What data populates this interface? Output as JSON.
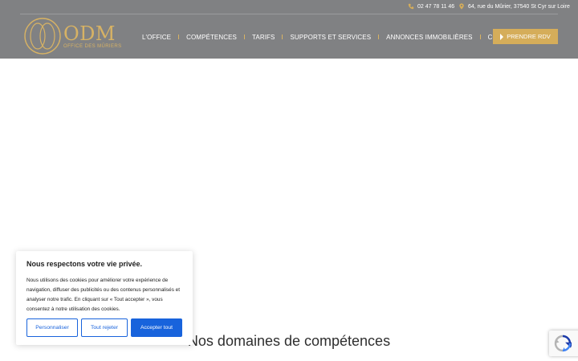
{
  "header": {
    "phone": "02 47 78 11 46",
    "address": "64, rue du Mûrier, 37540 St Cyr sur Loire",
    "logo": {
      "word": "ODM",
      "subtitle": "OFFICE DES MÛRIERS"
    },
    "nav": [
      {
        "label": "L'OFFICE"
      },
      {
        "label": "COMPÉTENCES"
      },
      {
        "label": "TARIFS"
      },
      {
        "label": "SUPPORTS ET SERVICES"
      },
      {
        "label": "ANNONCES IMMOBILIÈRES"
      },
      {
        "label": "CONTACT"
      }
    ],
    "cta_label": "PRENDRE RDV"
  },
  "main": {
    "section_title": "Nos domaines de compétences"
  },
  "cookie": {
    "title": "Nous respectons votre vie privée.",
    "text": "Nous utilisons des cookies pour améliorer votre expérience de navigation, diffuser des publicités ou des contenus personnalisés et analyser notre trafic. En cliquant sur « Tout accepter », vous consentez à notre utilisation des cookies.",
    "customize_label": "Personnaliser",
    "reject_label": "Tout rejeter",
    "accept_label": "Accepter tout"
  },
  "colors": {
    "header_bg": "#808183",
    "gold": "#d5ad5a",
    "cookie_blue": "#1863dc"
  },
  "icons": {
    "phone": "phone-icon",
    "address": "map-pin-icon",
    "cta": "play-triangle-icon",
    "recaptcha": "recaptcha-icon"
  }
}
